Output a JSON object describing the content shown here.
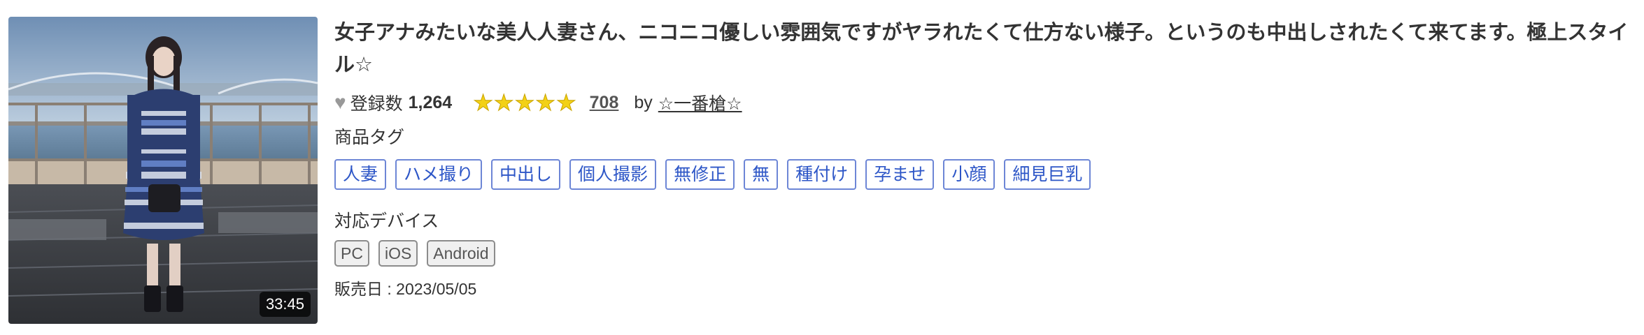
{
  "item": {
    "title": "女子アナみたいな美人人妻さん、ニコニコ優しい雰囲気ですがヤラれたくて仕方ない様子。というのも中出しされたくて来てます。極上スタイル☆",
    "duration": "33:45",
    "thumbnail_alt": "video thumbnail",
    "registrations": {
      "label": "登録数",
      "count": "1,264",
      "icon": "heart-icon"
    },
    "rating": {
      "stars": 5,
      "max": 5,
      "review_count": "708"
    },
    "by_label": "by",
    "author": "☆一番槍☆",
    "tags_label": "商品タグ",
    "tags": [
      "人妻",
      "ハメ撮り",
      "中出し",
      "個人撮影",
      "無修正",
      "無",
      "種付け",
      "孕ませ",
      "小顔",
      "細見巨乳"
    ],
    "devices_label": "対応デバイス",
    "devices": [
      "PC",
      "iOS",
      "Android"
    ],
    "release": "販売日 : 2023/05/05"
  },
  "colors": {
    "tag_text": "#2d56c7",
    "tag_border": "#6d86d6",
    "star": "#f3d116",
    "heart": "#999999"
  }
}
